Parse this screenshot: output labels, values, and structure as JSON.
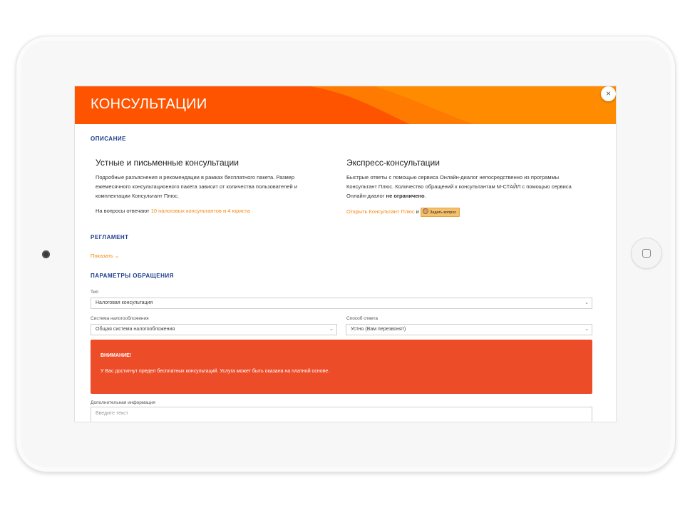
{
  "header": {
    "title": "КОНСУЛЬТАЦИИ",
    "close_icon": "×"
  },
  "colors": {
    "brand_orange": "#fe5400",
    "accent_orange": "#f28a12",
    "heading_blue": "#1d3e8e",
    "alert_red": "#ec4c28"
  },
  "description": {
    "section_title": "ОПИСАНИЕ",
    "left": {
      "title": "Устные и письменные консультации",
      "text": "Подробные разъяснения и рекомендации в рамках бесплатного пакета. Размер ежемесячного консультационного пакета зависит от количества пользователей и комплектации Консультант Плюс.",
      "answer_prefix": "На вопросы отвечают ",
      "answer_link": "10 налоговых консультантов и 4 юриста"
    },
    "right": {
      "title": "Экспресс-консультации",
      "text": "Быстрые ответы с помощью сервиса Онлайн-диалог непосредственно из программы Консультант Плюс. Количество обращений к консультантам М-СТАЙЛ с помощью сервиса Онлайн-диалог ",
      "text_bold": "не ограничено",
      "text_end": ".",
      "open_link": "Открыть Консультант Плюс",
      "conjunction": " и ",
      "ask_button": "Задать вопрос"
    }
  },
  "regulation": {
    "section_title": "РЕГЛАМЕНТ",
    "show_link": "Показать",
    "show_icon": "⌄"
  },
  "params": {
    "section_title": "ПАРАМЕТРЫ ОБРАЩЕНИЯ",
    "type": {
      "label": "Тип",
      "value": "Налоговая консультация"
    },
    "tax_system": {
      "label": "Система налогообложения",
      "value": "Общая система налогообложения"
    },
    "answer_method": {
      "label": "Способ ответа",
      "value": "Устно (Вам перезвонят)"
    },
    "chevron_icon": "⌄"
  },
  "alert": {
    "title": "ВНИМАНИЕ!",
    "text": "У Вас достигнут предел бесплатных консультаций. Услуга может быть оказана на платной основе."
  },
  "additional": {
    "label": "Дополнительная информация",
    "placeholder": "Введите текст"
  }
}
